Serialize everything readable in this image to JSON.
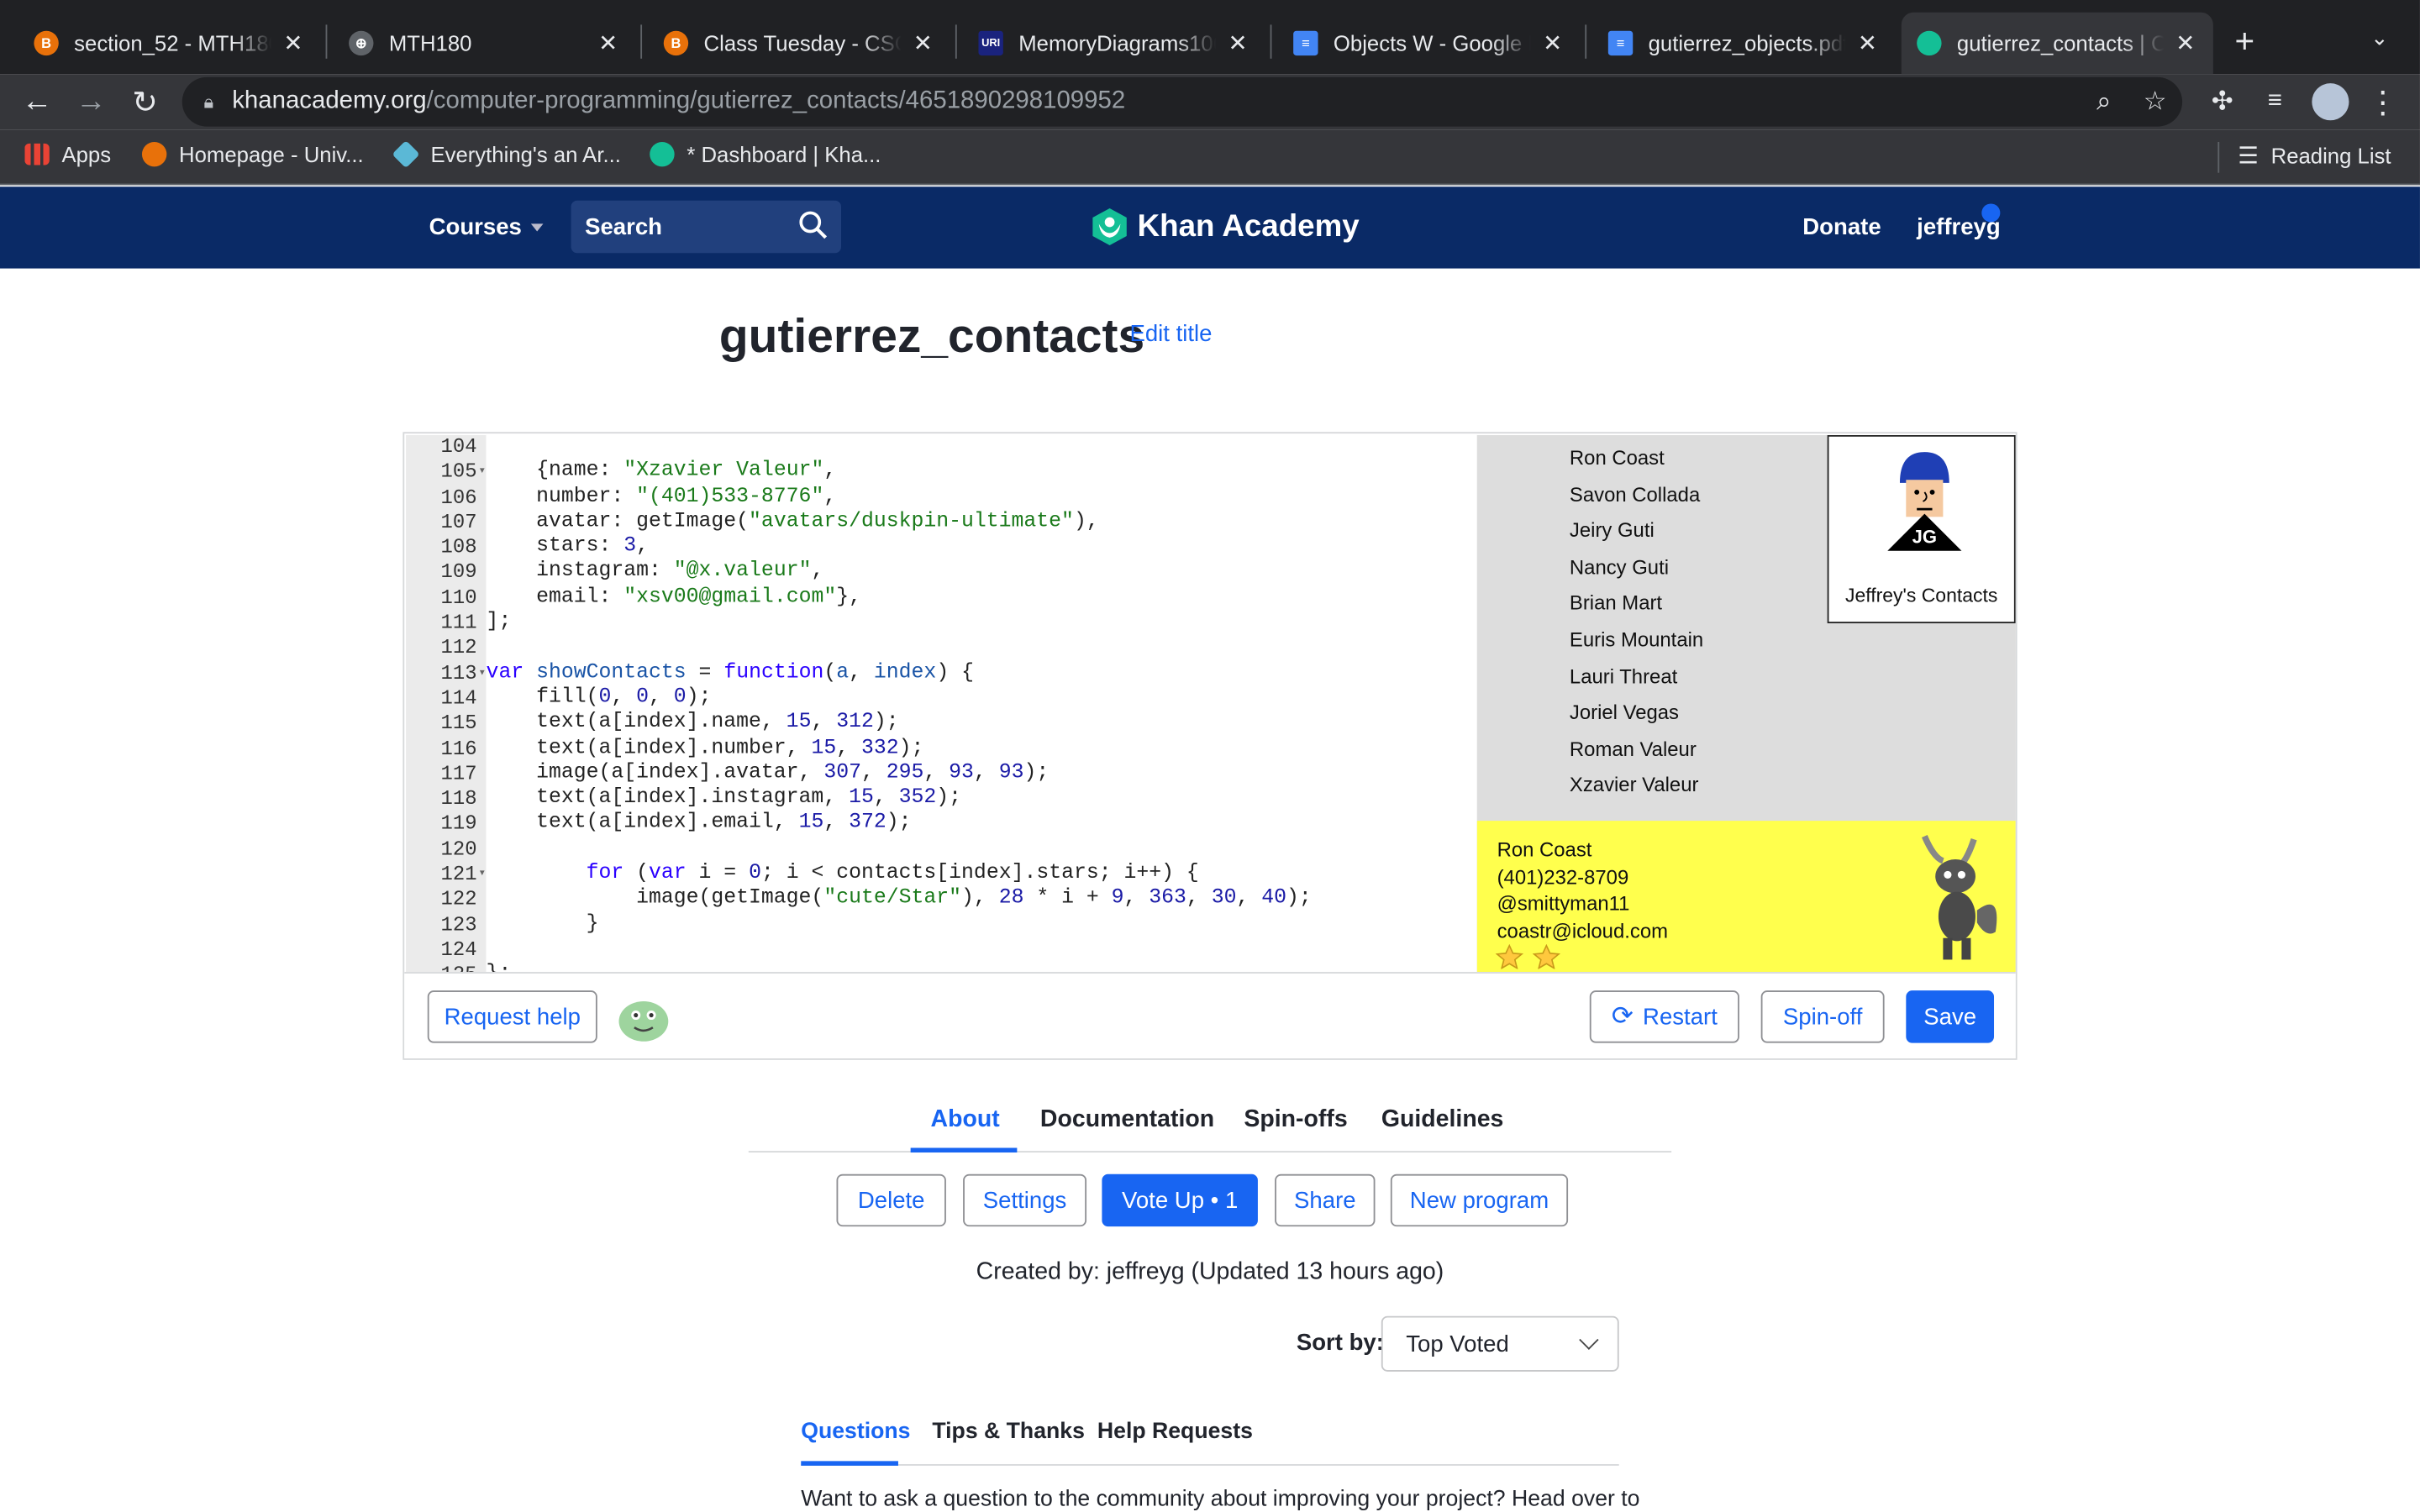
{
  "browser": {
    "tabs": [
      {
        "title": "section_52 - MTH180",
        "favicon_color": "#e8710a",
        "favicon_glyph": "B"
      },
      {
        "title": "MTH180",
        "favicon_color": "#5f6368",
        "favicon_glyph": "⊕"
      },
      {
        "title": "Class Tuesday - CSC1",
        "favicon_color": "#e8710a",
        "favicon_glyph": "B"
      },
      {
        "title": "MemoryDiagrams106",
        "favicon_color": "#1a237e",
        "favicon_glyph": "URI"
      },
      {
        "title": "Objects W - Google D",
        "favicon_color": "#4285f4",
        "favicon_glyph": "≡"
      },
      {
        "title": "gutierrez_objects.pdf",
        "favicon_color": "#4285f4",
        "favicon_glyph": "≡"
      },
      {
        "title": "gutierrez_contacts | C",
        "favicon_color": "#14bf96",
        "favicon_glyph": "◆"
      }
    ],
    "active_tab": 6,
    "url_domain": "khanacademy.org",
    "url_path": "/computer-programming/gutierrez_contacts/4651890298109952",
    "bookmarks": [
      "Apps",
      "Homepage - Univ...",
      "Everything's an Ar...",
      "* Dashboard | Kha..."
    ],
    "reading_list": "Reading List"
  },
  "header": {
    "courses": "Courses",
    "search": "Search",
    "brand": "Khan Academy",
    "donate": "Donate",
    "user": "jeffreyg"
  },
  "page": {
    "title": "gutierrez_contacts",
    "edit_title": "Edit title"
  },
  "editor": {
    "line_numbers": [
      "104",
      "105",
      "106",
      "107",
      "108",
      "109",
      "110",
      "111",
      "112",
      "113",
      "114",
      "115",
      "116",
      "117",
      "118",
      "119",
      "120",
      "121",
      "122",
      "123",
      "124",
      "125"
    ],
    "fold_lines": [
      "105",
      "113",
      "121"
    ]
  },
  "canvas": {
    "names": [
      "Ron Coast",
      "Savon Collada",
      "Jeiry Guti",
      "Nancy Guti",
      "Brian Mart",
      "Euris Mountain",
      "Lauri Threat",
      "Joriel Vegas",
      "Roman Valeur",
      "Xzavier Valeur"
    ],
    "card_label": "Jeffrey's Contacts",
    "avatar_initials": "JG",
    "contact": {
      "name": "Ron Coast",
      "number": "(401)232-8709",
      "instagram": "@smittyman11",
      "email": "coastr@icloud.com",
      "stars": 2
    }
  },
  "editor_buttons": {
    "request_help": "Request help",
    "restart": "Restart",
    "spinoff": "Spin-off",
    "save": "Save"
  },
  "about_tabs": [
    "About",
    "Documentation",
    "Spin-offs",
    "Guidelines"
  ],
  "actions": {
    "delete": "Delete",
    "settings": "Settings",
    "vote_up": "Vote Up • 1",
    "share": "Share",
    "new_program": "New program"
  },
  "created_by": "Created by: jeffreyg (Updated 13 hours ago)",
  "sort": {
    "label": "Sort by:",
    "value": "Top Voted"
  },
  "question_tabs": [
    "Questions",
    "Tips & Thanks",
    "Help Requests"
  ],
  "promo_text": "Want to ask a question to the community about improving your project? Head over to"
}
